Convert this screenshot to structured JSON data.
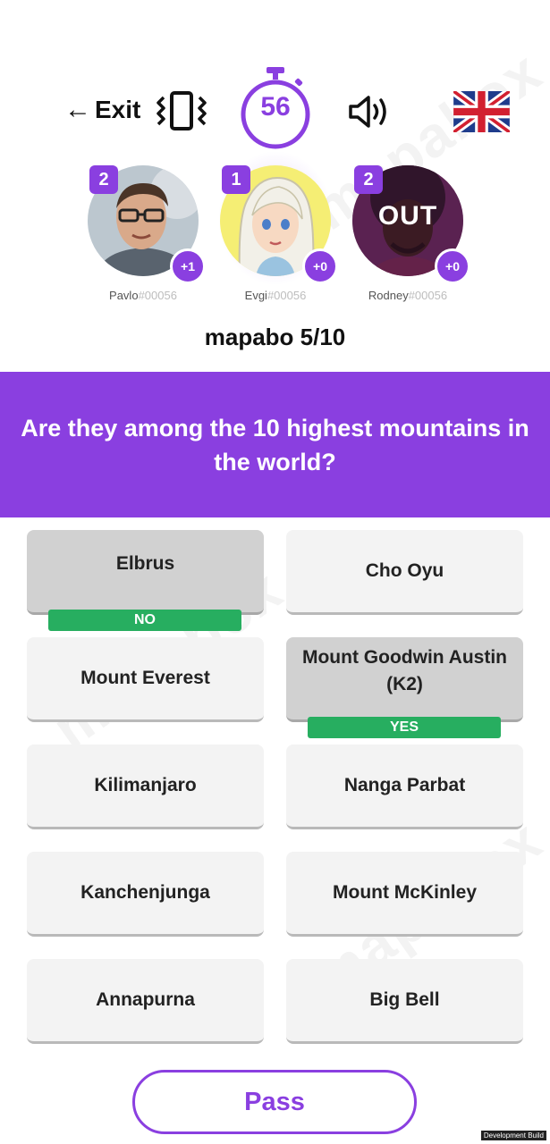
{
  "header": {
    "exit_label": "Exit",
    "timer_value": "56",
    "language_flag": "uk-flag"
  },
  "players": [
    {
      "rank": "2",
      "name": "Pavlo",
      "tag": "#00056",
      "score": "+1",
      "status": ""
    },
    {
      "rank": "1",
      "name": "Evgi",
      "tag": "#00056",
      "score": "+0",
      "status": ""
    },
    {
      "rank": "2",
      "name": "Rodney",
      "tag": "#00056",
      "score": "+0",
      "status": "OUT"
    }
  ],
  "round_label": "mapabo 5/10",
  "question": "Are they among the 10 highest mountains in the world?",
  "answers": [
    {
      "label": "Elbrus",
      "state": "selected",
      "verdict": "NO"
    },
    {
      "label": "Cho Oyu",
      "state": "",
      "verdict": ""
    },
    {
      "label": "Mount Everest",
      "state": "",
      "verdict": ""
    },
    {
      "label": "Mount Goodwin Austin (K2)",
      "state": "selected",
      "verdict": "YES"
    },
    {
      "label": "Kilimanjaro",
      "state": "",
      "verdict": ""
    },
    {
      "label": "Nanga Parbat",
      "state": "",
      "verdict": ""
    },
    {
      "label": "Kanchenjunga",
      "state": "",
      "verdict": ""
    },
    {
      "label": "Mount McKinley",
      "state": "",
      "verdict": ""
    },
    {
      "label": "Annapurna",
      "state": "",
      "verdict": ""
    },
    {
      "label": "Big Bell",
      "state": "",
      "verdict": ""
    }
  ],
  "pass_label": "Pass",
  "watermark": "mapabox",
  "build_note": "Development Build",
  "colors": {
    "accent": "#8a3fe0",
    "success": "#27ae60",
    "card": "#f3f3f3",
    "card_selected": "#d1d1d1"
  }
}
